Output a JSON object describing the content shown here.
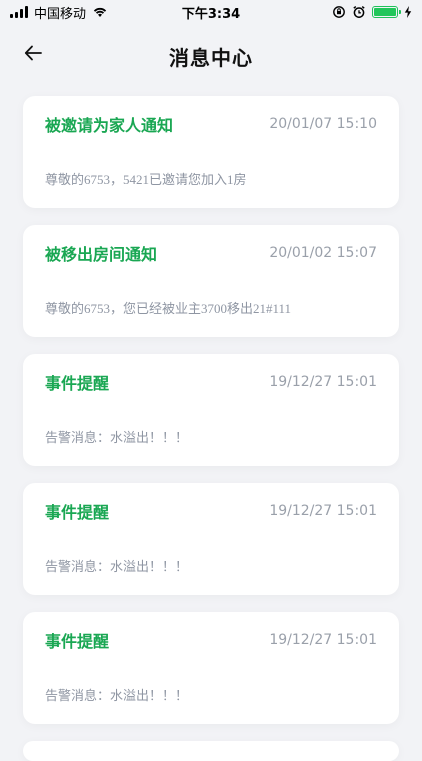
{
  "status_bar": {
    "carrier": "中国移动",
    "time": "下午3:34",
    "battery_level": 1.0,
    "colors": {
      "battery": "#21c65a"
    }
  },
  "header": {
    "title": "消息中心",
    "back_icon": "arrow-left-icon"
  },
  "colors": {
    "accent": "#1aa753",
    "background": "#f2f3f6",
    "muted_text": "#8f96a3"
  },
  "messages": [
    {
      "title": "被邀请为家人通知",
      "time": "20/01/07 15:10",
      "body": "尊敬的6753，5421已邀请您加入1房"
    },
    {
      "title": "被移出房间通知",
      "time": "20/01/02 15:07",
      "body": "尊敬的6753，您已经被业主3700移出21#111"
    },
    {
      "title": "事件提醒",
      "time": "19/12/27 15:01",
      "body": "告警消息：水溢出！！！"
    },
    {
      "title": "事件提醒",
      "time": "19/12/27 15:01",
      "body": "告警消息：水溢出！！！"
    },
    {
      "title": "事件提醒",
      "time": "19/12/27 15:01",
      "body": "告警消息：水溢出！！！"
    }
  ]
}
